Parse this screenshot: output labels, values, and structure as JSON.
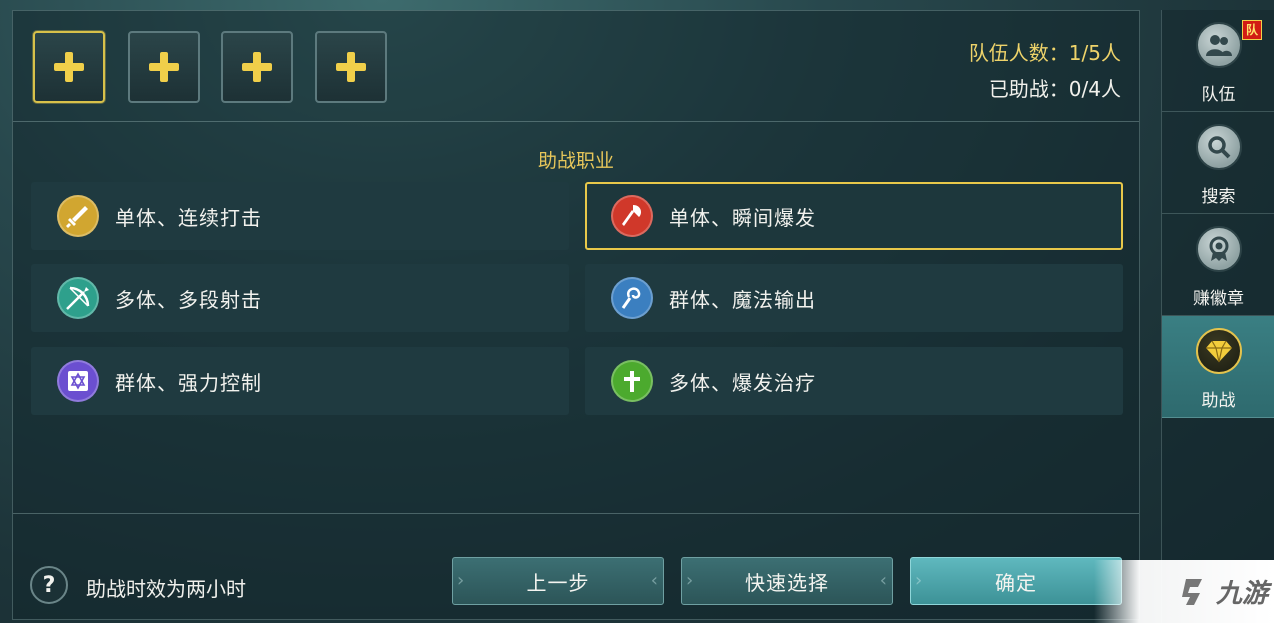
{
  "team_slots": [
    {
      "icon": "plus-icon",
      "selected": true
    },
    {
      "icon": "plus-icon",
      "selected": false
    },
    {
      "icon": "plus-icon",
      "selected": false
    },
    {
      "icon": "plus-icon",
      "selected": false
    }
  ],
  "status": {
    "team_count": "队伍人数：1/5人",
    "helped_count": "已助战：0/4人"
  },
  "section_title": "助战职业",
  "classes": [
    {
      "label": "单体、连续打击",
      "icon": "sword-icon",
      "color": "#d1a630",
      "selected": false
    },
    {
      "label": "单体、瞬间爆发",
      "icon": "axe-icon",
      "color": "#d0382a",
      "selected": true
    },
    {
      "label": "多体、多段射击",
      "icon": "bow-icon",
      "color": "#2ea08c",
      "selected": false
    },
    {
      "label": "群体、魔法输出",
      "icon": "staff-icon",
      "color": "#3b7fc0",
      "selected": false
    },
    {
      "label": "群体、强力控制",
      "icon": "hexagram-icon",
      "color": "#6b4fd0",
      "selected": false
    },
    {
      "label": "多体、爆发治疗",
      "icon": "cross-icon",
      "color": "#4caa2e",
      "selected": false
    }
  ],
  "footer": {
    "help_icon": "?",
    "help_text": "助战时效为两小时",
    "buttons": {
      "prev": "上一步",
      "quick": "快速选择",
      "confirm": "确定"
    }
  },
  "sidebar": [
    {
      "label": "队伍",
      "icon": "team-icon",
      "badge": "队",
      "active": false
    },
    {
      "label": "搜索",
      "icon": "magnifier-icon",
      "active": false
    },
    {
      "label": "赚徽章",
      "icon": "medal-icon",
      "active": false
    },
    {
      "label": "助战",
      "icon": "diamond-icon",
      "active": true
    }
  ],
  "watermark": "九游",
  "colors": {
    "accent_gold": "#e8c84a",
    "primary_button": "#4aa3a8"
  }
}
